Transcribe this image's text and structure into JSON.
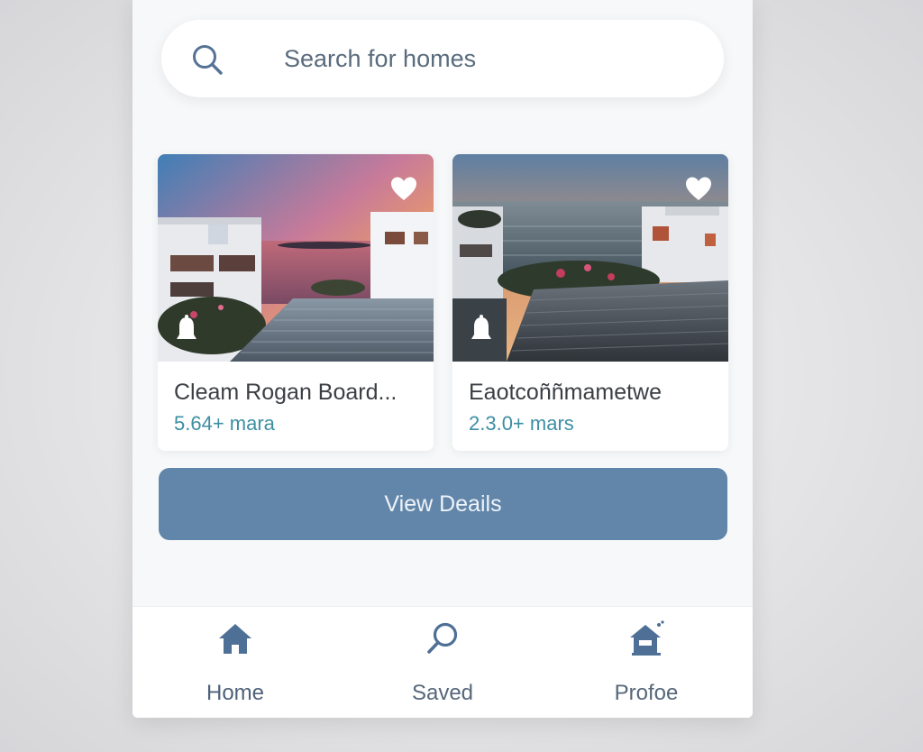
{
  "search": {
    "placeholder": "Search for homes",
    "icon": "search-icon"
  },
  "listings": [
    {
      "title": "Cleam Rogan Board...",
      "subtitle": "5.64+ mara",
      "favorite_icon": "heart-icon",
      "badge_icon": "bell-icon"
    },
    {
      "title": "Eaotcoññmametwe",
      "subtitle": "2.3.0+ mars",
      "favorite_icon": "heart-icon",
      "badge_icon": "bell-icon"
    }
  ],
  "actions": {
    "view_details_label": "View Deails"
  },
  "nav": {
    "items": [
      {
        "label": "Home",
        "icon": "home-icon"
      },
      {
        "label": "Saved",
        "icon": "search-icon"
      },
      {
        "label": "Profoe",
        "icon": "house-profile-icon"
      }
    ]
  },
  "colors": {
    "accent": "#6286aa",
    "subtitle": "#3d8fa3",
    "nav_icon": "#4e6f96",
    "background": "#f7f8f9"
  }
}
